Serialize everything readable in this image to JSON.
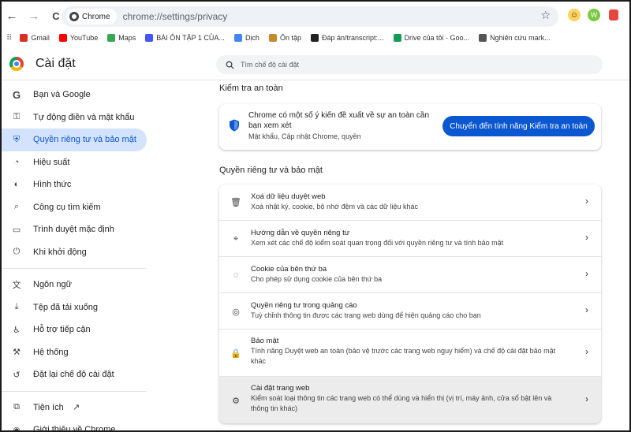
{
  "browser": {
    "back_icon": "←",
    "forward_icon": "→",
    "reload_icon": "C",
    "chip_label": "Chrome",
    "url": "chrome://settings/privacy",
    "star_icon": "☆",
    "profile_initial": "W"
  },
  "bookmarks": [
    {
      "label": "Gmail",
      "icon": "gmail-icon",
      "color": "#d93025"
    },
    {
      "label": "YouTube",
      "icon": "youtube-icon",
      "color": "#ff0000"
    },
    {
      "label": "Maps",
      "icon": "maps-icon",
      "color": "#34a853"
    },
    {
      "label": "BÀI ÔN TẬP 1 CỦA...",
      "icon": "quizlet-icon",
      "color": "#4255ff"
    },
    {
      "label": "Dịch",
      "icon": "translate-icon",
      "color": "#4285f4"
    },
    {
      "label": "Ôn tập",
      "icon": "study-icon",
      "color": "#c58a2b"
    },
    {
      "label": "Đáp án/transcript:...",
      "icon": "page-icon",
      "color": "#222222"
    },
    {
      "label": "Drive của tôi - Goo...",
      "icon": "drive-icon",
      "color": "#0f9d58"
    },
    {
      "label": "Nghiên cứu mark...",
      "icon": "folder-icon",
      "color": "#555555"
    }
  ],
  "header": {
    "title": "Cài đặt",
    "search_placeholder": "Tìm chế độ cài đặt"
  },
  "sidebar": {
    "items": [
      {
        "label": "Bạn và Google",
        "icon": "G"
      },
      {
        "label": "Tự động điền và mật khẩu",
        "icon": "⚿"
      },
      {
        "label": "Quyền riêng tư và bảo mật",
        "icon": "⛨"
      },
      {
        "label": "Hiệu suất",
        "icon": "◔"
      },
      {
        "label": "Hình thức",
        "icon": "◐"
      },
      {
        "label": "Công cụ tìm kiếm",
        "icon": "⌕"
      },
      {
        "label": "Trình duyệt mặc định",
        "icon": "▭"
      },
      {
        "label": "Khi khởi động",
        "icon": "⏻"
      },
      {
        "label": "Ngôn ngữ",
        "icon": "文"
      },
      {
        "label": "Tệp đã tải xuống",
        "icon": "⤓"
      },
      {
        "label": "Hỗ trợ tiếp cận",
        "icon": "♿"
      },
      {
        "label": "Hệ thống",
        "icon": "⚒"
      },
      {
        "label": "Đặt lại chế độ cài đặt",
        "icon": "↺"
      },
      {
        "label": "Tiện ích",
        "icon": "⧉"
      },
      {
        "label": "Giới thiệu về Chrome",
        "icon": "◉"
      }
    ]
  },
  "main": {
    "safety_section_title": "Kiểm tra an toàn",
    "safety_card": {
      "title": "Chrome có một số ý kiến đề xuất về sự an toàn cần bạn xem xét",
      "subtitle": "Mật khẩu, Cập nhật Chrome, quyền",
      "button": "Chuyển đến tính năng Kiểm tra an toàn"
    },
    "privacy_section_title": "Quyền riêng tư và bảo mật",
    "rows": [
      {
        "title": "Xoá dữ liệu duyệt web",
        "desc": "Xoá nhật ký, cookie, bộ nhớ đệm và các dữ liệu khác",
        "icon": "🗑"
      },
      {
        "title": "Hướng dẫn về quyền riêng tư",
        "desc": "Xem xét các chế độ kiểm soát quan trọng đối với quyền riêng tư và tính bảo mật",
        "icon": "⌖"
      },
      {
        "title": "Cookie của bên thứ ba",
        "desc": "Cho phép sử dụng cookie của bên thứ ba",
        "icon": "◌"
      },
      {
        "title": "Quyền riêng tư trong quảng cáo",
        "desc": "Tuỳ chỉnh thông tin được các trang web dùng để hiện quảng cáo cho bạn",
        "icon": "◎"
      },
      {
        "title": "Bảo mật",
        "desc": "Tính năng Duyệt web an toàn (bảo vệ trước các trang web nguy hiểm) và chế độ cài đặt bảo mật khác",
        "icon": "🔒"
      },
      {
        "title": "Cài đặt trang web",
        "desc": "Kiểm soát loại thông tin các trang web có thể dùng và hiển thị (vị trí, máy ảnh, cửa sổ bật lên và thông tin khác)",
        "icon": "⚙"
      }
    ],
    "chevron": "›"
  }
}
